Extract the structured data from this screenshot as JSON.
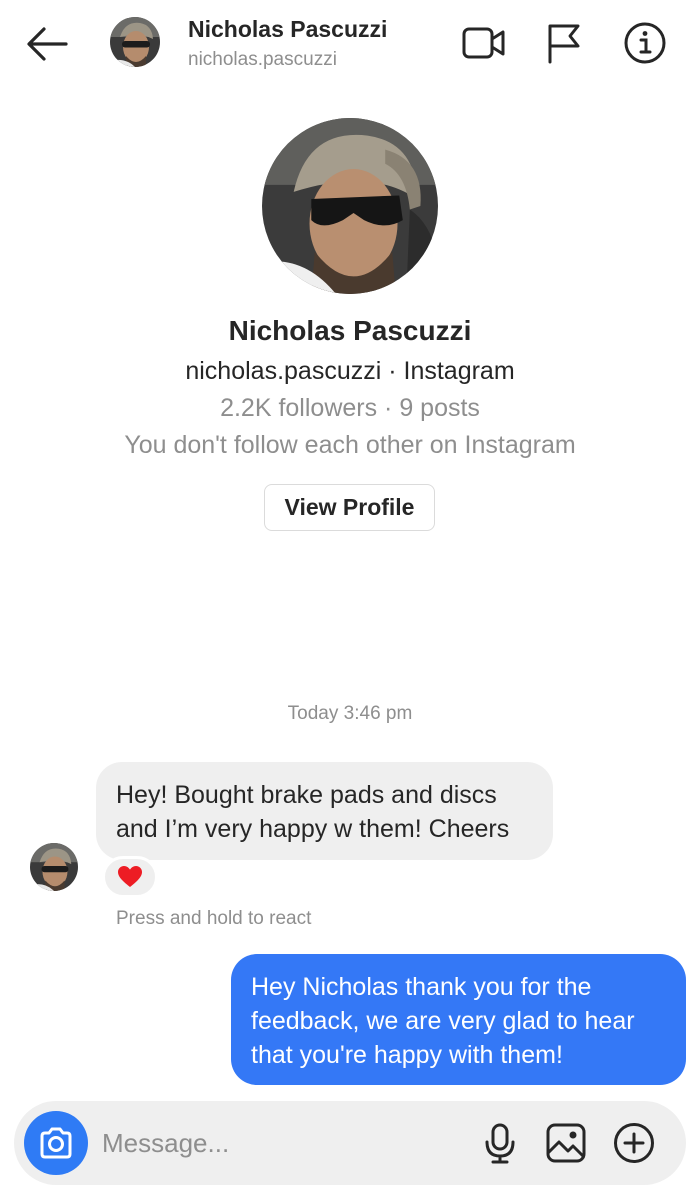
{
  "header": {
    "name": "Nicholas Pascuzzi",
    "username": "nicholas.pascuzzi"
  },
  "profile": {
    "name": "Nicholas Pascuzzi",
    "handle_line": "nicholas.pascuzzi · Instagram",
    "stats_line": "2.2K followers · 9 posts",
    "follow_status": "You don't follow each other on Instagram",
    "view_profile_label": "View Profile"
  },
  "conversation": {
    "timestamp": "Today 3:46 pm",
    "incoming": {
      "text": "Hey! Bought brake pads and discs and I’m very happy w them! Cheers",
      "reaction": "heart"
    },
    "hint": "Press and hold to react",
    "outgoing": {
      "text": "Hey Nicholas thank you for the feedback, we are very glad to hear that you're happy with them!"
    }
  },
  "composer": {
    "placeholder": "Message..."
  },
  "colors": {
    "accent": "#3478f6",
    "camera_button": "#2f7bf5",
    "incoming_bubble": "#efefef",
    "reaction_heart": "#ed1c24"
  },
  "icons": [
    "back-arrow-icon",
    "video-call-icon",
    "flag-icon",
    "info-icon",
    "heart-icon",
    "camera-icon",
    "microphone-icon",
    "gallery-icon",
    "plus-icon"
  ]
}
